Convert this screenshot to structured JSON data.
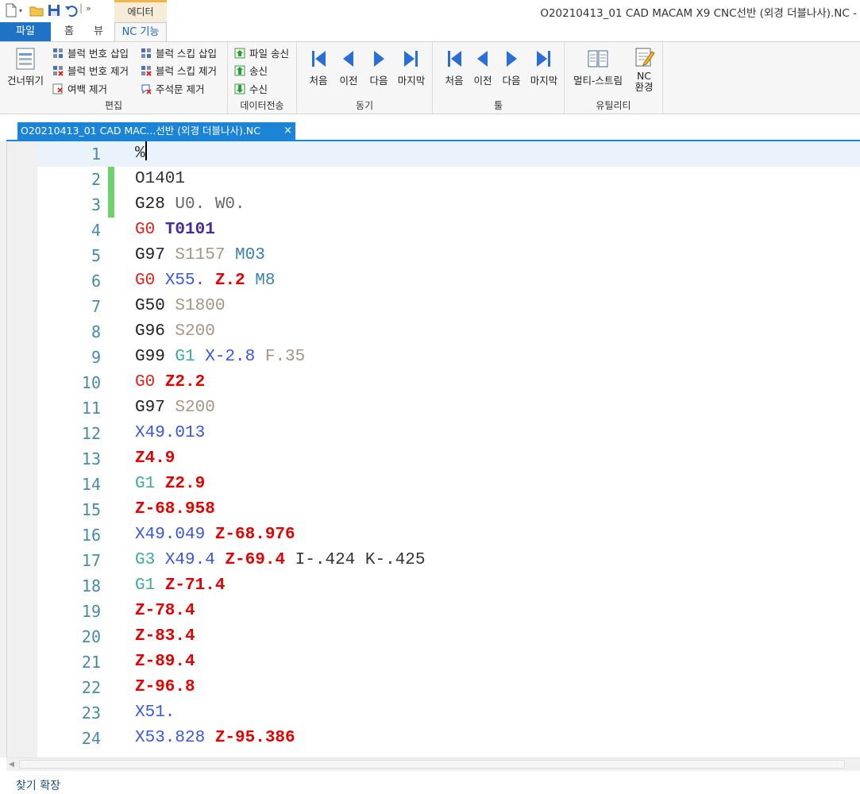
{
  "titlebar": {
    "context_tab": "에디터",
    "window_title": "O20210413_01 CAD MACAM X9 CNC선반 (외경 더블나사).NC -",
    "quick_access": [
      "new-file-icon",
      "open-folder-icon",
      "save-icon",
      "undo-icon",
      "more-icon"
    ]
  },
  "ribbon_tabs": [
    {
      "label": "파일"
    },
    {
      "label": "홈"
    },
    {
      "label": "뷰"
    },
    {
      "label": "NC 기능"
    }
  ],
  "ribbon": {
    "edit": {
      "caption": "편집",
      "skip": "건너뛰기",
      "block_num_insert": "블럭 번호 삽입",
      "block_num_remove": "블럭 번호 제거",
      "whitespace_remove": "여백 제거",
      "block_skip_insert": "블럭 스킵 삽입",
      "block_skip_remove": "블럭 스킵 제거",
      "comment_remove": "주석문 제거"
    },
    "transfer": {
      "caption": "데이터전송",
      "file_send": "파일 송신",
      "send": "송신",
      "receive": "수신"
    },
    "sync": {
      "caption": "동기",
      "first": "처음",
      "prev": "이전",
      "next": "다음",
      "last": "마지막"
    },
    "tool": {
      "caption": "툴",
      "first": "처음",
      "prev": "이전",
      "next": "다음",
      "last": "마지막"
    },
    "utility": {
      "caption": "유틸리티",
      "multistream": "멀티-스트림",
      "nc_env_1": "NC",
      "nc_env_2": "환경"
    }
  },
  "document_tab": {
    "label": "O20210413_01 CAD MAC...선반 (외경 더블나사).NC",
    "close": "×"
  },
  "editor": {
    "lines": [
      {
        "n": "1",
        "tokens": [
          [
            "o",
            "%"
          ]
        ]
      },
      {
        "n": "2",
        "tokens": [
          [
            "o",
            "O1401"
          ]
        ]
      },
      {
        "n": "3",
        "tokens": [
          [
            "g",
            "G28"
          ],
          [
            "u",
            " U0. W0."
          ]
        ]
      },
      {
        "n": "4",
        "tokens": [
          [
            "g0",
            "G0"
          ],
          [
            "t",
            " T0101"
          ]
        ]
      },
      {
        "n": "5",
        "tokens": [
          [
            "g",
            "G97"
          ],
          [
            "s",
            " S1157"
          ],
          [
            "m",
            " M03"
          ]
        ]
      },
      {
        "n": "6",
        "tokens": [
          [
            "g0",
            "G0"
          ],
          [
            "x",
            " X55."
          ],
          [
            "z",
            " Z.2"
          ],
          [
            "m",
            " M8"
          ]
        ]
      },
      {
        "n": "7",
        "tokens": [
          [
            "g",
            "G50"
          ],
          [
            "s",
            " S1800"
          ]
        ]
      },
      {
        "n": "8",
        "tokens": [
          [
            "g",
            "G96"
          ],
          [
            "s",
            " S200"
          ]
        ]
      },
      {
        "n": "9",
        "tokens": [
          [
            "g",
            "G99"
          ],
          [
            "g1",
            " G1"
          ],
          [
            "x",
            " X-2.8"
          ],
          [
            "f",
            " F.35"
          ]
        ]
      },
      {
        "n": "10",
        "tokens": [
          [
            "g0",
            "G0"
          ],
          [
            "z",
            " Z2.2"
          ]
        ]
      },
      {
        "n": "11",
        "tokens": [
          [
            "g",
            "G97"
          ],
          [
            "s",
            " S200"
          ]
        ]
      },
      {
        "n": "12",
        "tokens": [
          [
            "x",
            "X49.013"
          ]
        ]
      },
      {
        "n": "13",
        "tokens": [
          [
            "z",
            "Z4.9"
          ]
        ]
      },
      {
        "n": "14",
        "tokens": [
          [
            "g1",
            "G1"
          ],
          [
            "z",
            " Z2.9"
          ]
        ]
      },
      {
        "n": "15",
        "tokens": [
          [
            "z",
            "Z-68.958"
          ]
        ]
      },
      {
        "n": "16",
        "tokens": [
          [
            "x",
            "X49.049"
          ],
          [
            "z",
            " Z-68.976"
          ]
        ]
      },
      {
        "n": "17",
        "tokens": [
          [
            "g1",
            "G3"
          ],
          [
            "x",
            " X49.4"
          ],
          [
            "z",
            " Z-69.4"
          ],
          [
            "ik",
            " I-.424 K-.425"
          ]
        ]
      },
      {
        "n": "18",
        "tokens": [
          [
            "g1",
            "G1"
          ],
          [
            "z",
            " Z-71.4"
          ]
        ]
      },
      {
        "n": "19",
        "tokens": [
          [
            "z",
            "Z-78.4"
          ]
        ]
      },
      {
        "n": "20",
        "tokens": [
          [
            "z",
            "Z-83.4"
          ]
        ]
      },
      {
        "n": "21",
        "tokens": [
          [
            "z",
            "Z-89.4"
          ]
        ]
      },
      {
        "n": "22",
        "tokens": [
          [
            "z",
            "Z-96.8"
          ]
        ]
      },
      {
        "n": "23",
        "tokens": [
          [
            "x",
            "X51."
          ]
        ]
      },
      {
        "n": "24",
        "tokens": [
          [
            "x",
            "X53.828"
          ],
          [
            "z",
            " Z-95.386"
          ]
        ]
      }
    ]
  },
  "status": {
    "find_expand": "찾기 확장"
  }
}
